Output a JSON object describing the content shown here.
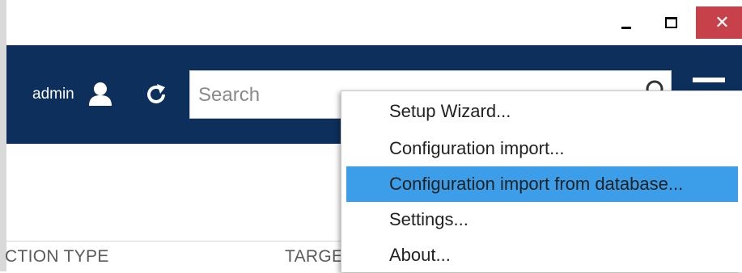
{
  "window": {
    "controls": {
      "minimize": "minimize",
      "maximize": "maximize",
      "close": "✕"
    }
  },
  "header": {
    "user_label": "admin",
    "search": {
      "placeholder": "Search",
      "value": ""
    },
    "colors": {
      "header_bg": "#0d2f5c",
      "close_bg": "#c7414a",
      "selected_bg": "#3c9ee8"
    }
  },
  "table": {
    "columns": [
      "CTION TYPE",
      "TARGE"
    ]
  },
  "menu": {
    "items": [
      {
        "label": "Setup Wizard..."
      },
      {
        "label": "Configuration import..."
      },
      {
        "label": "Configuration import from database...",
        "selected": true
      },
      {
        "label": "Settings..."
      },
      {
        "label": "About..."
      }
    ]
  },
  "icons": [
    "user-icon",
    "refresh-icon",
    "search-icon",
    "hamburger-menu-icon",
    "minimize-icon",
    "maximize-icon",
    "close-icon"
  ]
}
